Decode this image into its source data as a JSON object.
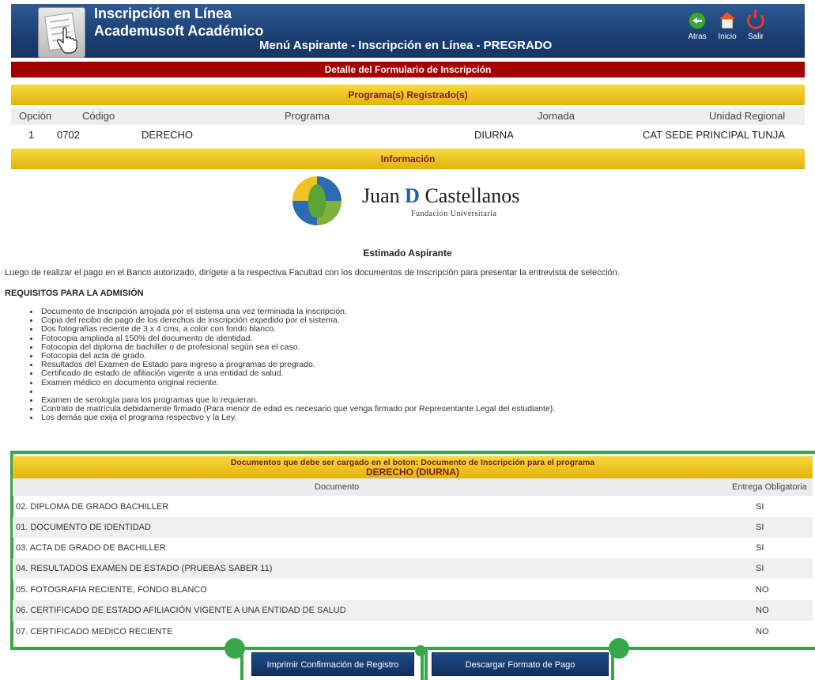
{
  "header": {
    "app_title_line1": "Inscripción en Línea",
    "app_title_line2": "Academusoft Académico",
    "menu_title": "Menú Aspirante - Inscripción en Línea - PREGRADO",
    "nav": [
      {
        "label": "Atras",
        "icon": "back-arrow-icon"
      },
      {
        "label": "Inicio",
        "icon": "home-icon"
      },
      {
        "label": "Salir",
        "icon": "power-icon"
      }
    ]
  },
  "detail_title": "Detalle del Formulario de Inscripción",
  "programs": {
    "title": "Programa(s) Registrado(s)",
    "columns": [
      "Opción",
      "Código",
      "Programa",
      "Jornada",
      "Unidad Regional"
    ],
    "rows": [
      {
        "opcion": "1",
        "codigo": "0702",
        "programa": "DERECHO",
        "jornada": "DIURNA",
        "unidad": "CAT SEDE PRINCIPAL TUNJA"
      }
    ]
  },
  "information": {
    "title": "Información",
    "brand_name_prefix": "Juan",
    "brand_name_d": "D",
    "brand_name_suffix": "Castellanos",
    "brand_subtitle": "Fundación Universitaria",
    "greeting": "Estimado Aspirante",
    "intro": "Luego de realizar el  pago en el Banco autorizado, dirígete a la respectiva Facultad con los documentos de Inscripción para presentar la entrevista de selección.",
    "requirements_title": "REQUISITOS  PARA LA ADMISIÓN",
    "requirements": [
      "Documento de Inscripción arrojada por el sistema una vez terminada la inscripción.",
      "Copia del recibo de pago de los derechos de inscripción expedido por el sistema.",
      "Dos fotografías reciente de 3 x 4 cms, a color con fondo blanco.",
      "Fotocopia ampliada al 150% del documento de identidad.",
      "Fotocopia del diploma de bachiller o de profesional según sea el caso.",
      "Fotocopia del acta de grado.",
      "Resultados del Examen de Estado para ingreso a programas de pregrado.",
      "Certificado de estado de afiliación vigente a una entidad de salud.",
      "Examen médico en documento original reciente.",
      "",
      "Examen de serología para los programas que lo requieran.",
      "Contrato de matrícula debidamente firmado (Para menor de edad es necesario que venga firmado por Representante Legal del estudiante).",
      "Los demás que exija el programa respectivo y la Ley."
    ]
  },
  "documents": {
    "title_line1": "Documentos que debe ser cargado en el boton: Documento de Inscripción para el programa",
    "title_line2": "DERECHO (DIURNA)",
    "columns": [
      "Documento",
      "Entrega Obligatoria"
    ],
    "rows": [
      {
        "documento": "02. DIPLOMA DE GRADO BACHILLER",
        "obligatoria": "SI"
      },
      {
        "documento": "01. DOCUMENTO DE IDENTIDAD",
        "obligatoria": "SI"
      },
      {
        "documento": "03. ACTA DE GRADO DE BACHILLER",
        "obligatoria": "SI"
      },
      {
        "documento": "04. RESULTADOS EXAMEN DE ESTADO (PRUEBAS SABER 11)",
        "obligatoria": "SI"
      },
      {
        "documento": "05. FOTOGRAFIA RECIENTE, FONDO BLANCO",
        "obligatoria": "NO"
      },
      {
        "documento": "06. CERTIFICADO DE ESTADO AFILIACIÓN VIGENTE A UNA ENTIDAD DE SALUD",
        "obligatoria": "NO"
      },
      {
        "documento": "07. CERTIFICADO MEDICO RECIENTE",
        "obligatoria": "NO"
      }
    ]
  },
  "actions": {
    "print_label": "Imprimir Confirmación de Registro",
    "download_label": "Descargar Formato de Pago"
  },
  "colors": {
    "header_blue": "#1a3f73",
    "red_bar": "#a50000",
    "yellow_bar": "#f0c325",
    "highlight_green": "#3aa64a",
    "button_blue": "#153f75"
  }
}
